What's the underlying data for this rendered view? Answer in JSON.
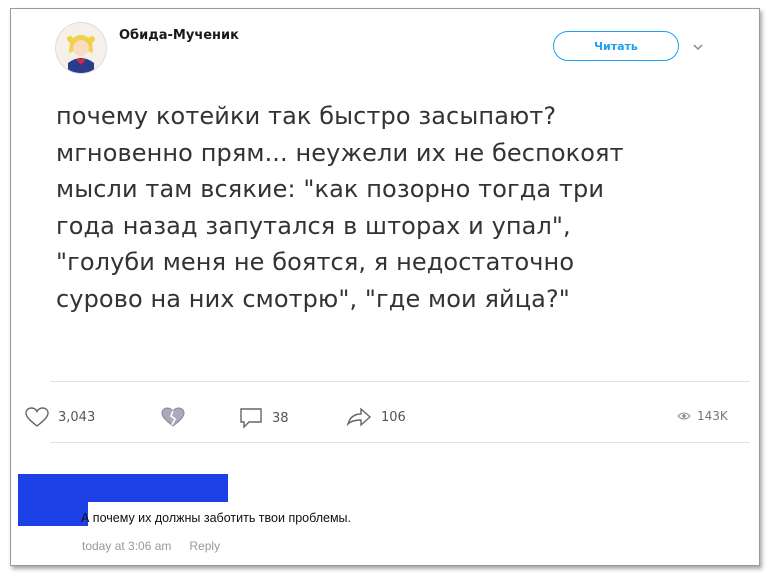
{
  "tweet": {
    "author": "Обида-Мученик",
    "follow_label": "Читать",
    "text": "почему котейки так быстро засыпают?\nмгновенно прям... неужели их не беспокоят\nмысли там всякие: \"как позорно тогда три\nгода назад запутался в шторах и упал\",\n\"голуби меня не боятся, я недостаточно\nсурово на них смотрю\", \"где мои яйца?\"",
    "likes": "3,043",
    "replies": "38",
    "shares": "106",
    "views": "143K"
  },
  "comment": {
    "text": "А почему их должны заботить твои проблемы.",
    "time": "today at 3:06 am",
    "reply_label": "Reply"
  },
  "colors": {
    "accent": "#1da1f2",
    "redaction": "#1d3fe6"
  },
  "icons": [
    "avatar-image",
    "chevron-down-icon",
    "heart-icon",
    "broken-heart-icon",
    "comment-icon",
    "share-icon",
    "eye-icon"
  ]
}
